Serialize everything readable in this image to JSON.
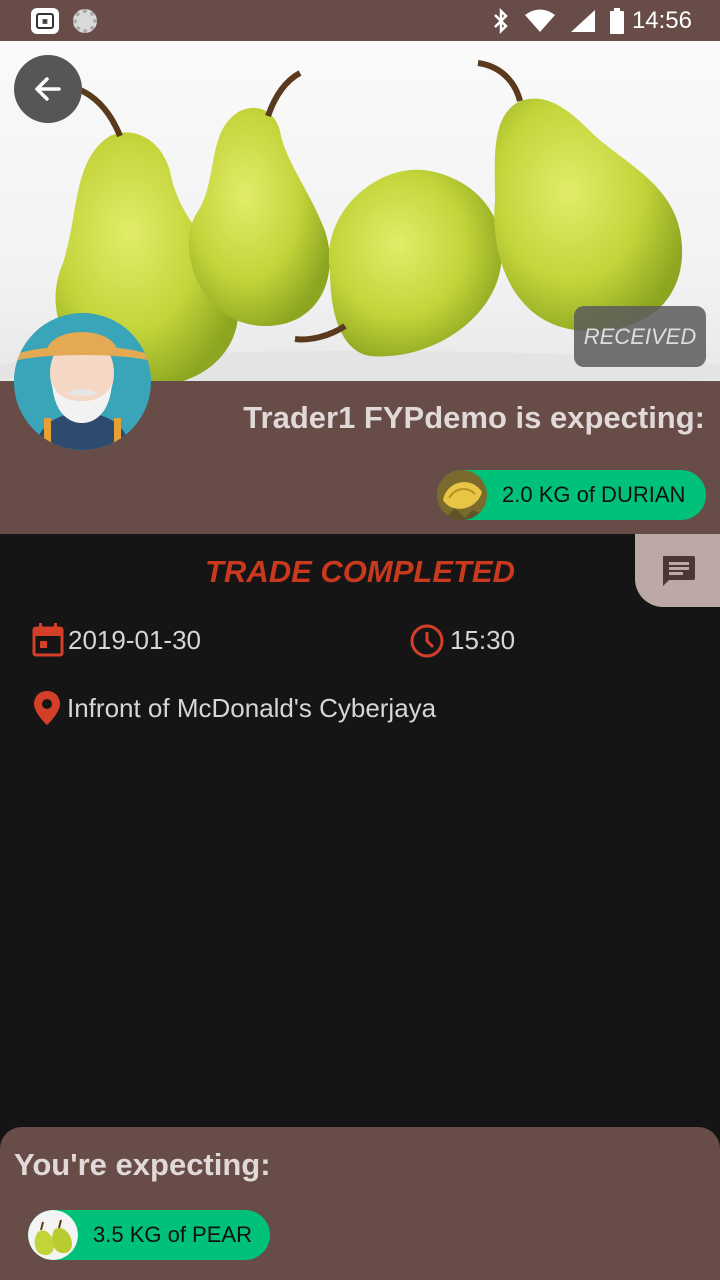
{
  "status_bar": {
    "time": "14:56",
    "icons": [
      "app-icon",
      "spinner-icon",
      "bluetooth-icon",
      "wifi-icon",
      "signal-icon",
      "battery-icon"
    ]
  },
  "hero": {
    "image": "pears-photo",
    "status_pill": "RECEIVED"
  },
  "trader": {
    "title": "Trader1 FYPdemo is expecting:",
    "item_chip": {
      "label": "2.0 KG of DURIAN",
      "icon": "durian-icon"
    }
  },
  "trade": {
    "status": "TRADE COMPLETED",
    "date": "2019-01-30",
    "time": "15:30",
    "location": "Infront of McDonald's Cyberjaya"
  },
  "you": {
    "title": "You're expecting:",
    "item_chip": {
      "label": "3.5 KG of PEAR",
      "icon": "pear-icon"
    }
  },
  "colors": {
    "brown_panel": "#684c48",
    "background": "#161516",
    "accent_red": "#c9391e",
    "chip_green": "#00c17a",
    "chat_tab": "#bca8a4"
  }
}
